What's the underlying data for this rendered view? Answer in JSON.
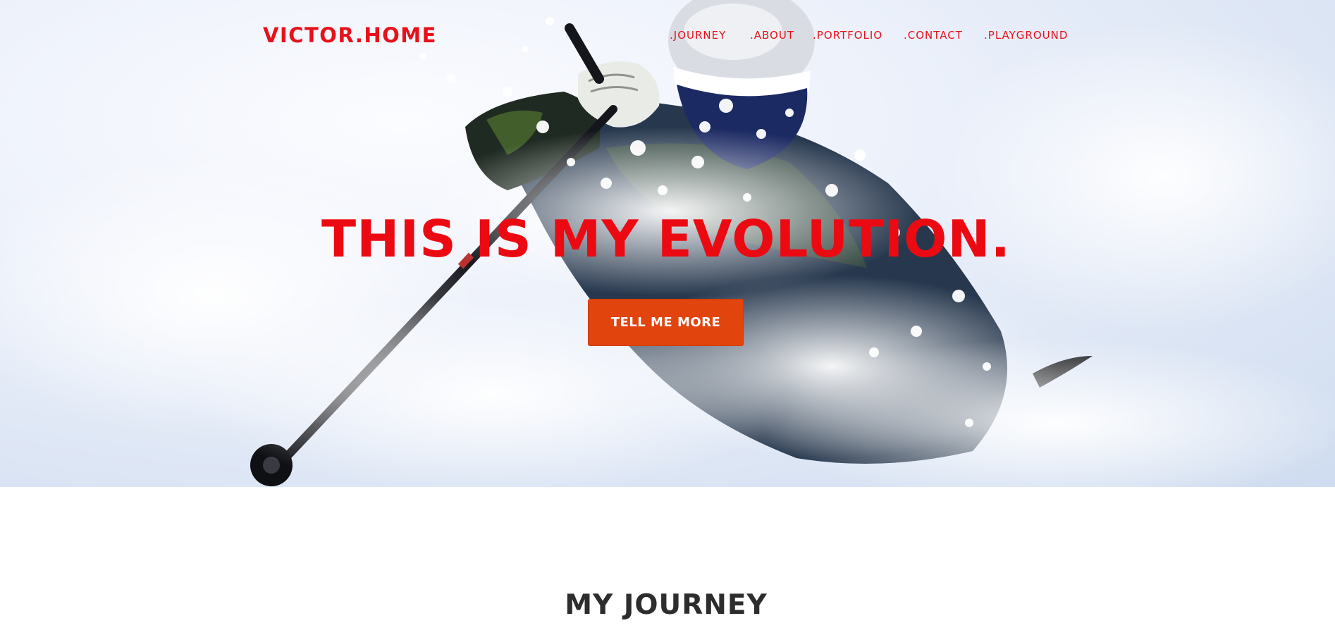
{
  "brand": {
    "name": "VICTOR.HOME"
  },
  "nav": {
    "items": [
      ".JOURNEY",
      ".ABOUT",
      ".PORTFOLIO",
      ".CONTACT",
      ".PLAYGROUND"
    ]
  },
  "hero": {
    "headline": "THIS IS MY EVOLUTION.",
    "cta_label": "TELL ME MORE"
  },
  "journey": {
    "title": "MY JOURNEY"
  },
  "colors": {
    "accent_red": "#ec0a12",
    "cta_orange": "#e2440d",
    "section_title": "#2d2d2d"
  },
  "icons": [
    "skier-photo"
  ]
}
